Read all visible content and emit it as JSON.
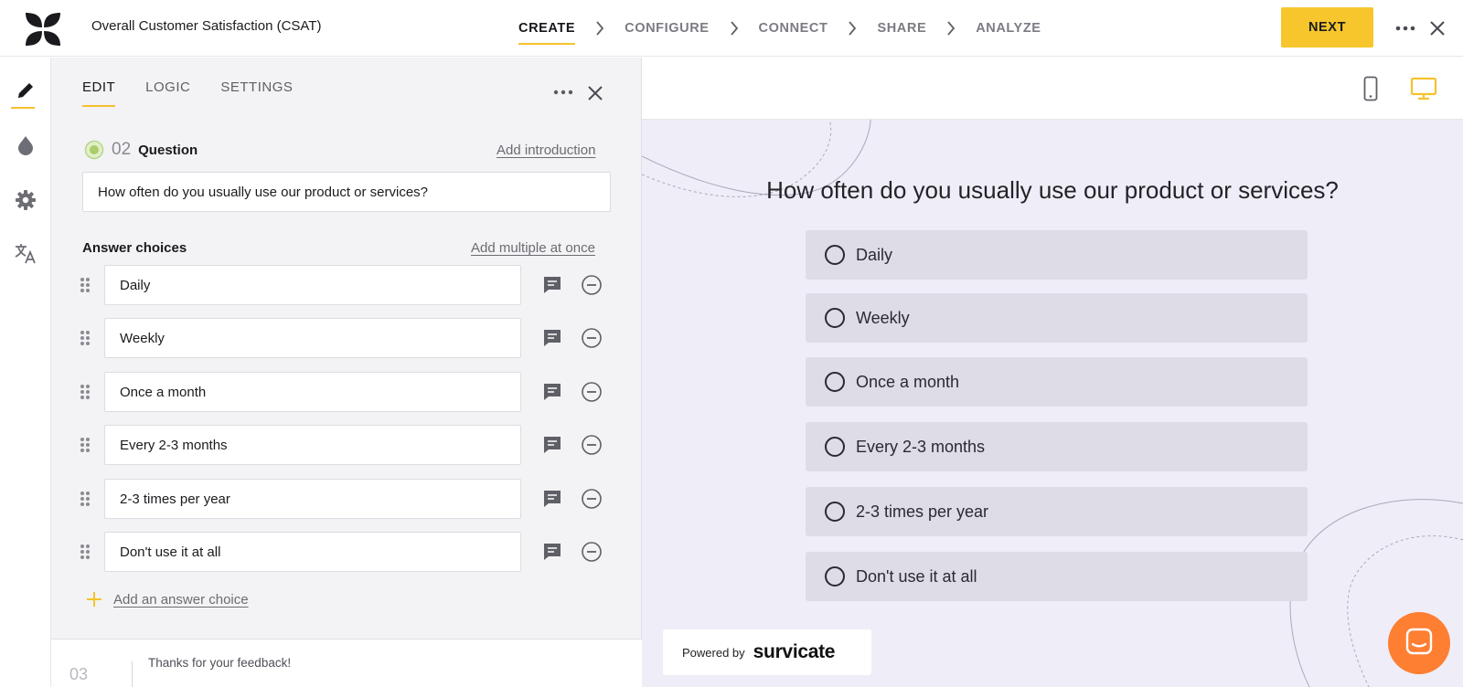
{
  "colors": {
    "accent": "#F5C22E",
    "chat": "#FE7F32",
    "preview_bg": "#EFEEF8",
    "option_bg": "#DDDCE7"
  },
  "header": {
    "logo_icon": "survicate-logo-icon",
    "survey_title": "Overall Customer Satisfaction (CSAT)",
    "steps": [
      "CREATE",
      "CONFIGURE",
      "CONNECT",
      "SHARE",
      "ANALYZE"
    ],
    "active_step": "CREATE",
    "next_label": "NEXT",
    "more_icon": "more-horizontal-icon",
    "close_icon": "close-icon"
  },
  "rail": {
    "items": [
      {
        "icon": "pencil-icon",
        "active": true
      },
      {
        "icon": "droplet-icon",
        "active": false
      },
      {
        "icon": "gear-icon",
        "active": false
      },
      {
        "icon": "translate-icon",
        "active": false
      }
    ]
  },
  "editor": {
    "tabs": [
      "EDIT",
      "LOGIC",
      "SETTINGS"
    ],
    "active_tab": "EDIT",
    "question_number": "02",
    "question_type_label": "Question",
    "add_introduction": "Add introduction",
    "question_text": "How often do you usually use our product or services?",
    "answer_choices_label": "Answer choices",
    "add_multiple": "Add multiple at once",
    "choices": [
      "Daily",
      "Weekly",
      "Once a month",
      "Every 2-3 months",
      "2-3 times per year",
      "Don't use it at all"
    ],
    "add_choice": "Add an answer choice",
    "next_question": {
      "number": "03",
      "text": "Thanks for your feedback!"
    }
  },
  "preview": {
    "devices": [
      "mobile-icon",
      "desktop-icon"
    ],
    "active_device": "desktop",
    "question": "How often do you usually use our product or services?",
    "options": [
      "Daily",
      "Weekly",
      "Once a month",
      "Every 2-3 months",
      "2-3 times per year",
      "Don't use it at all"
    ],
    "powered_by": "Powered by",
    "brand": "survicate",
    "chat_icon": "chat-bubble-icon"
  }
}
